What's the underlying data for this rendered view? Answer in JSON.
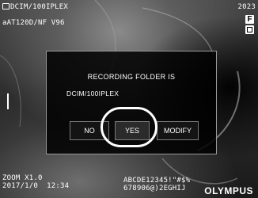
{
  "status": {
    "folder": "DCIM/100IPLEX",
    "line2": "aAT120D/NF V96",
    "top_right": "2023",
    "badge_f": "F"
  },
  "footer": {
    "zoom": "ZOOM X1.0",
    "datetime": "2017/1/0  12:34",
    "text_line1": "ABCDE12345!\"#$%",
    "text_line2": "678906@)2EGHIJ",
    "brand": "OLYMPUS"
  },
  "dialog": {
    "title": "RECORDING FOLDER IS",
    "folder": "DCIM/100IPLEX",
    "buttons": {
      "no": "NO",
      "yes": "YES",
      "modify": "MODIFY"
    }
  },
  "icons": [
    "folder-icon",
    "f-badge-icon",
    "card-icon",
    "level-bar-icon"
  ]
}
